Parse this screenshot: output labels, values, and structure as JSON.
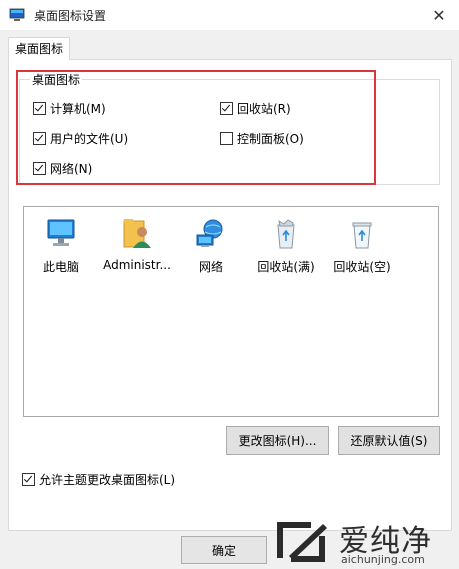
{
  "window": {
    "title": "桌面图标设置",
    "close_label": "✕"
  },
  "tabs": [
    "桌面图标"
  ],
  "group": {
    "legend": "桌面图标",
    "checkboxes": [
      {
        "label": "计算机(M)",
        "checked": true
      },
      {
        "label": "回收站(R)",
        "checked": true
      },
      {
        "label": "用户的文件(U)",
        "checked": true
      },
      {
        "label": "控制面板(O)",
        "checked": false
      },
      {
        "label": "网络(N)",
        "checked": true
      }
    ]
  },
  "icons": [
    {
      "label": "此电脑",
      "icon": "monitor-icon"
    },
    {
      "label": "Administr...",
      "icon": "user-folder-icon"
    },
    {
      "label": "网络",
      "icon": "network-globe-icon"
    },
    {
      "label": "回收站(满)",
      "icon": "recycle-bin-full-icon"
    },
    {
      "label": "回收站(空)",
      "icon": "recycle-bin-empty-icon"
    }
  ],
  "buttons": {
    "change_icon": "更改图标(H)...",
    "restore_default": "还原默认值(S)",
    "ok": "确定"
  },
  "allow_theme": {
    "label": "允许主题更改桌面图标(L)",
    "checked": true
  },
  "watermark": {
    "brand": "爱纯净",
    "url": "aichunjing.com"
  },
  "colors": {
    "highlight": "#d9363e",
    "accent": "#0a78d7"
  }
}
